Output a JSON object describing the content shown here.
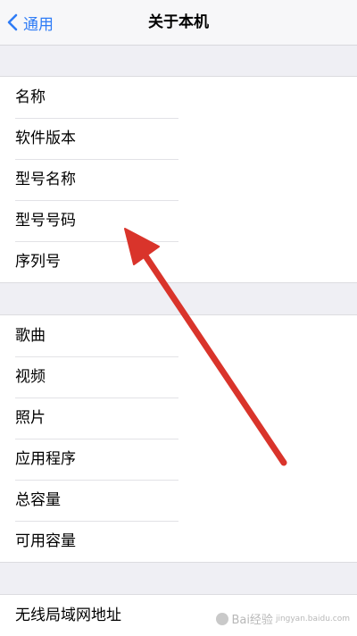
{
  "navbar": {
    "back_label": "通用",
    "title": "关于本机"
  },
  "groups": [
    {
      "items": [
        "名称",
        "软件版本",
        "型号名称",
        "型号号码",
        "序列号"
      ]
    },
    {
      "items": [
        "歌曲",
        "视频",
        "照片",
        "应用程序",
        "总容量",
        "可用容量"
      ]
    },
    {
      "items": [
        "无线局域网地址"
      ]
    }
  ],
  "watermark": {
    "text": "Bai经验",
    "url": "jingyan.baidu.com"
  },
  "colors": {
    "accent": "#2f7cf6",
    "arrow": "#d9342b",
    "background": "#efeff4"
  }
}
